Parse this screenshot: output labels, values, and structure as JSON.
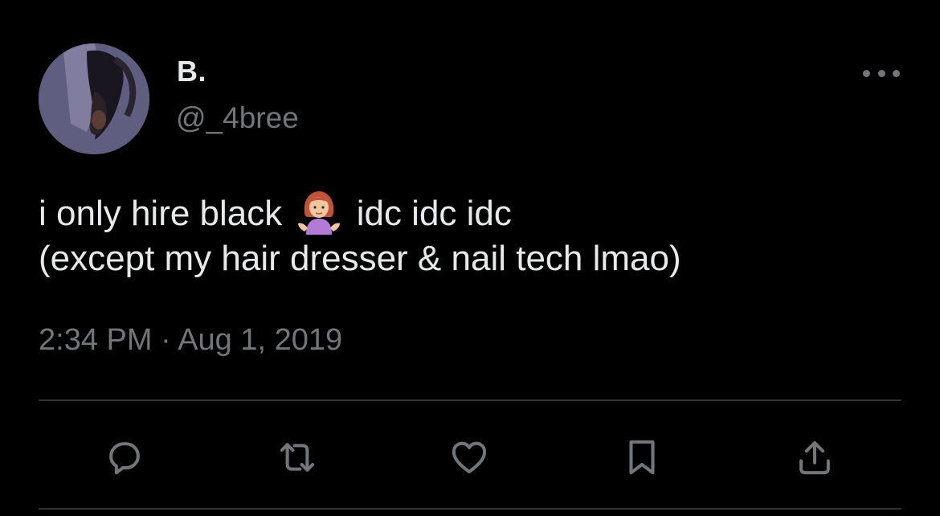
{
  "author": {
    "display_name": "B.",
    "handle": "@_4bree"
  },
  "tweet": {
    "text_before_emoji": "i only hire black",
    "emoji": "woman-shrugging",
    "text_after_emoji": "idc idc idc",
    "line2": "(except my hair dresser & nail tech lmao)"
  },
  "meta": {
    "timestamp": "2:34 PM · Aug 1, 2019"
  },
  "actions": [
    "reply-icon",
    "retweet-icon",
    "like-icon",
    "bookmark-icon",
    "share-icon"
  ],
  "colors": {
    "background": "#000000",
    "primary_text": "#e7e9ea",
    "secondary_text": "#71767b",
    "divider": "#2f3336"
  }
}
